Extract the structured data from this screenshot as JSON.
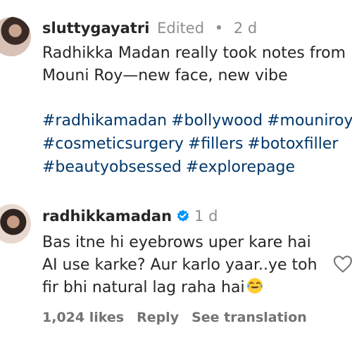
{
  "comments": [
    {
      "username": "sluttygayatri",
      "edited": "Edited",
      "separator": "•",
      "time": "2 d",
      "lines": [
        "Radhikka Madan really took notes from",
        "Mouni Roy—new face, new vibe"
      ],
      "hashtag_lines": [
        [
          "#radhikamadan",
          "#bollywood",
          "#mouniroy"
        ],
        [
          "#cosmeticsurgery",
          "#fillers",
          "#botoxfiller"
        ],
        [
          "#beautyobsessed",
          "#explorepage"
        ]
      ]
    },
    {
      "username": "radhikkamadan",
      "verified": true,
      "time": "1 d",
      "lines": [
        "Bas itne hi eyebrows uper kare hai",
        "AI use karke? Aur karlo yaar..ye toh",
        "fir bhi natural lag raha hai"
      ],
      "emoji": "face-with-tears-of-joy",
      "actions": {
        "likes": "1,024 likes",
        "reply": "Reply",
        "translate": "See translation"
      }
    }
  ],
  "icons": {
    "verified": "verified-badge-icon",
    "like": "heart-icon"
  },
  "colors": {
    "hashtag": "#00376b",
    "verified": "#0095f6",
    "meta": "#8e8e8e"
  }
}
